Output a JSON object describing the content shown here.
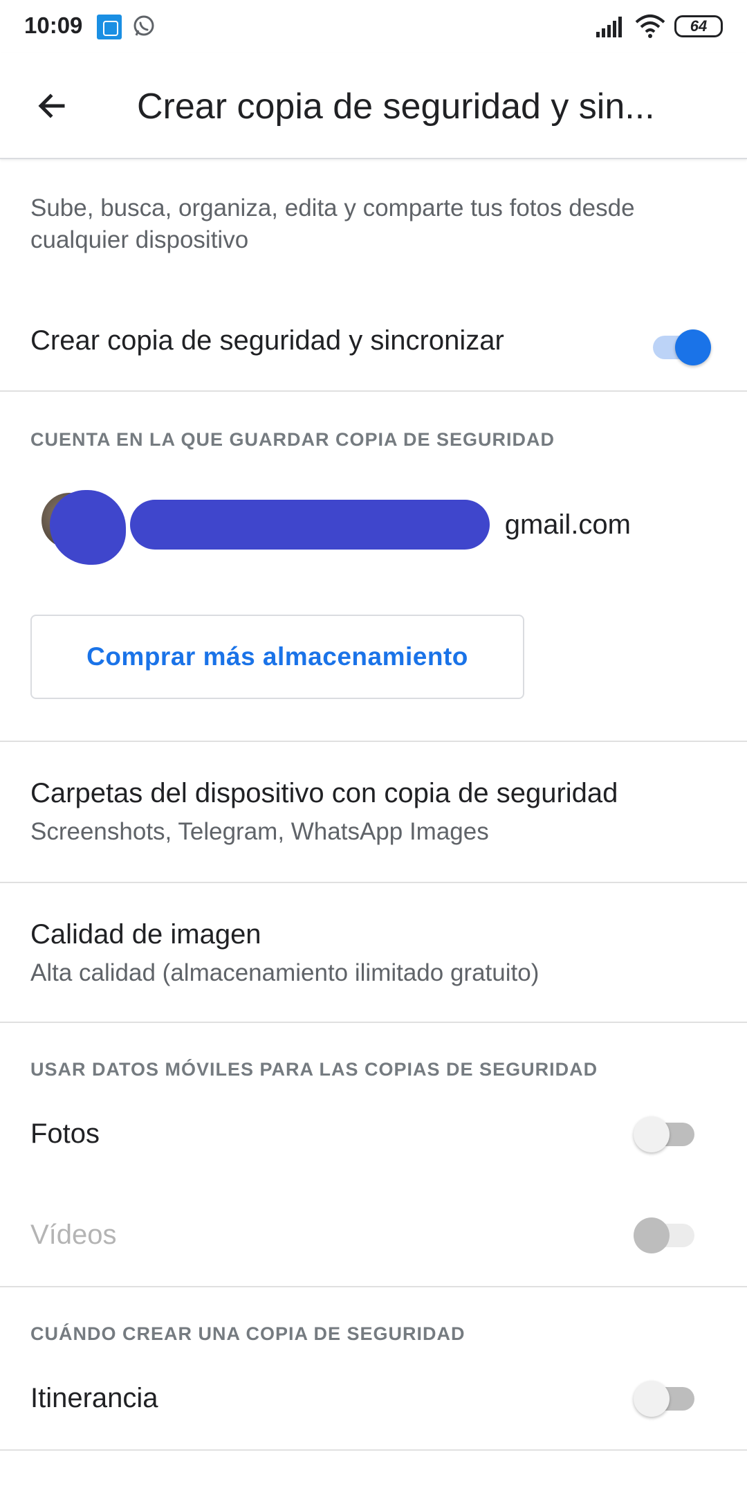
{
  "status_bar": {
    "time": "10:09",
    "battery_level": "64",
    "icons": [
      "mi-notification-icon",
      "whatsapp-icon",
      "signal-icon",
      "wifi-icon",
      "battery-icon"
    ]
  },
  "app_bar": {
    "back_icon": "arrow-back-icon",
    "title": "Crear copia de seguridad y sin..."
  },
  "description": "Sube, busca, organiza, edita y comparte tus fotos desde cualquier dispositivo",
  "backup_sync": {
    "label": "Crear copia de seguridad y sincronizar",
    "enabled": true
  },
  "account_section": {
    "header": "CUENTA EN LA QUE GUARDAR COPIA DE SEGURIDAD",
    "email_visible": "gmail.com",
    "buy_storage_label": "Comprar más almacenamiento"
  },
  "device_folders": {
    "title": "Carpetas del dispositivo con copia de seguridad",
    "subtitle": "Screenshots, Telegram, WhatsApp Images"
  },
  "image_quality": {
    "title": "Calidad de imagen",
    "subtitle": "Alta calidad (almacenamiento ilimitado gratuito)"
  },
  "mobile_data_section": {
    "header": "USAR DATOS MÓVILES PARA LAS COPIAS DE SEGURIDAD",
    "photos": {
      "label": "Fotos",
      "enabled": false
    },
    "videos": {
      "label": "Vídeos",
      "enabled": false,
      "disabled": true
    }
  },
  "when_section": {
    "header": "CUÁNDO CREAR UNA COPIA DE SEGURIDAD",
    "roaming": {
      "label": "Itinerancia",
      "enabled": false
    }
  },
  "colors": {
    "accent": "#1a73e8",
    "redaction": "#3f46cc",
    "secondary_text": "#5f6368"
  }
}
